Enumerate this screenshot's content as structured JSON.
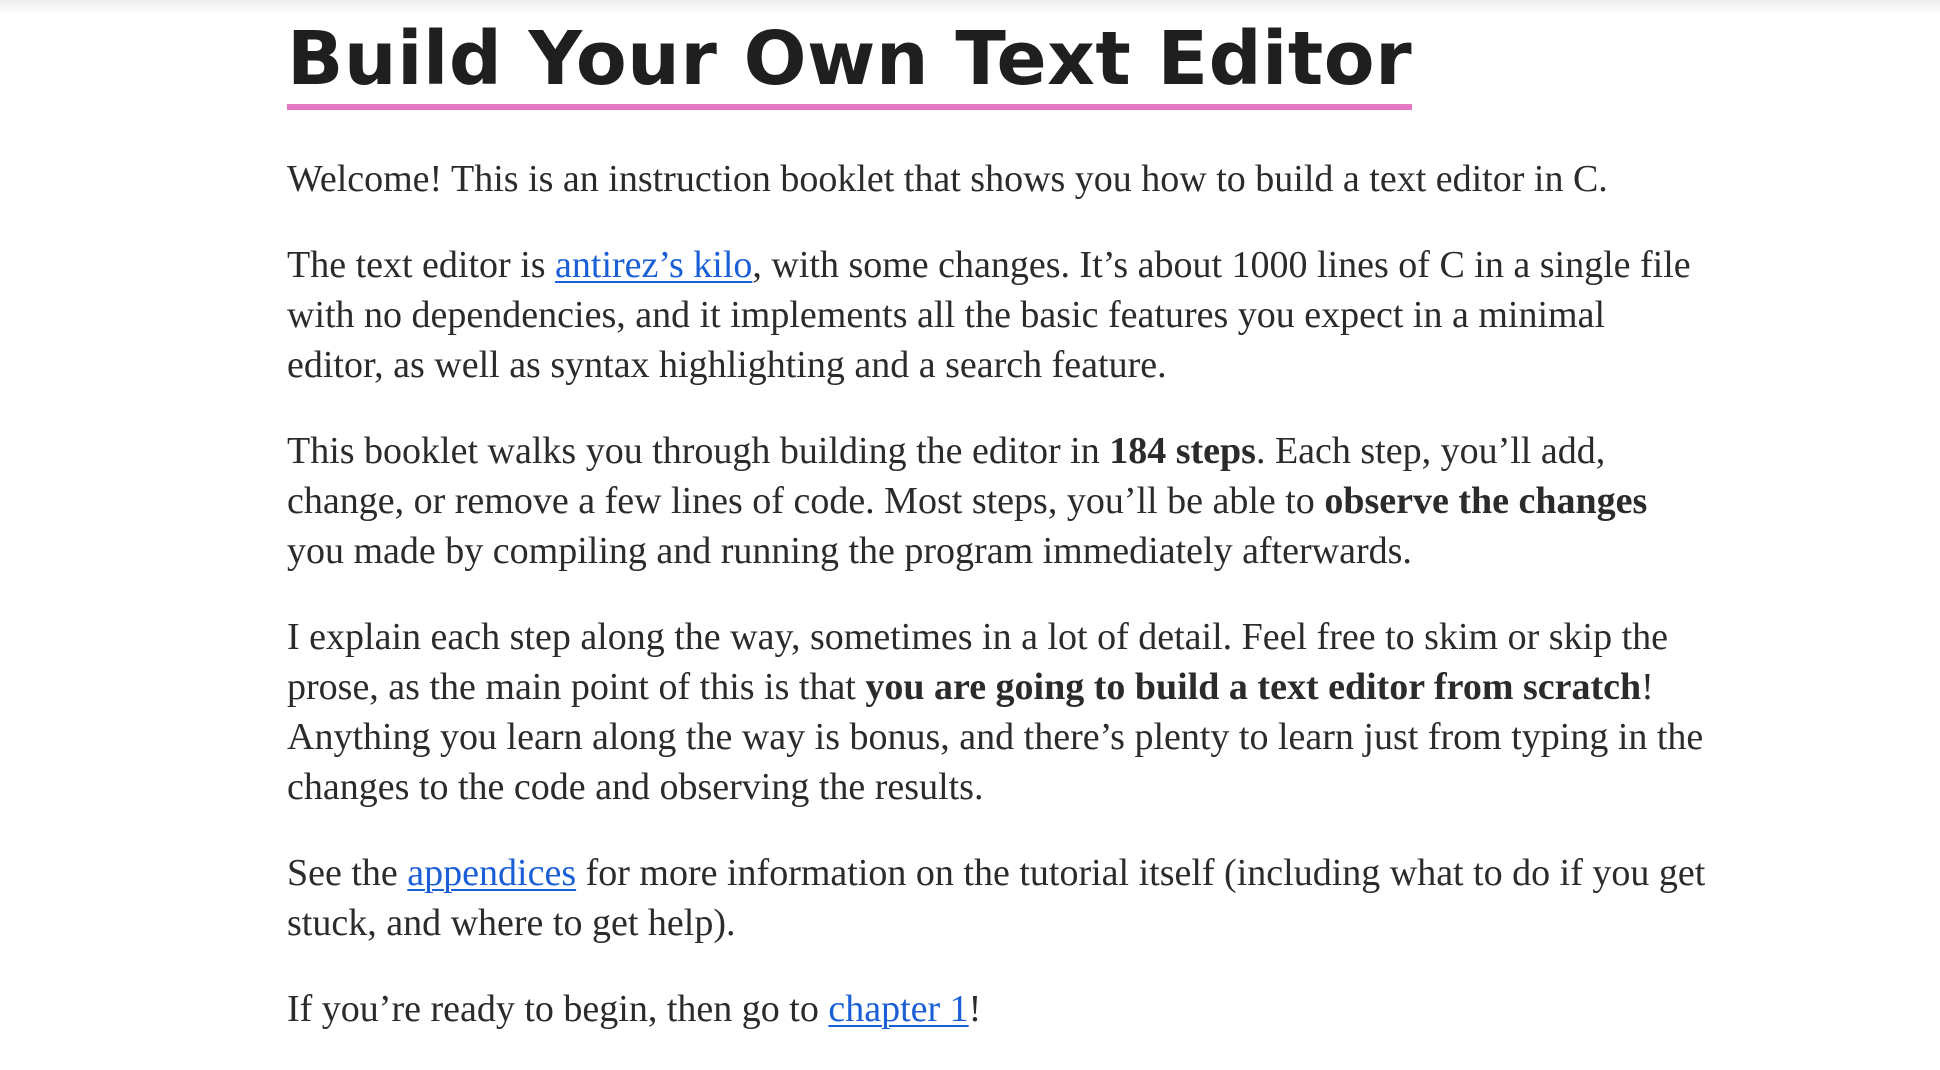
{
  "title": "Build Your Own Text Editor",
  "p1": {
    "text": "Welcome! This is an instruction booklet that shows you how to build a text editor in C."
  },
  "p2": {
    "t1": "The text editor is ",
    "link": "antirez’s kilo",
    "t2": ", with some changes. It’s about 1000 lines of C in a single file with no dependencies, and it implements all the basic features you expect in a minimal editor, as well as syntax highlighting and a search feature."
  },
  "p3": {
    "t1": "This booklet walks you through building the editor in ",
    "b1": "184 steps",
    "t2": ". Each step, you’ll add, change, or remove a few lines of code. Most steps, you’ll be able to ",
    "b2": "observe the changes",
    "t3": " you made by compiling and running the program immediately afterwards."
  },
  "p4": {
    "t1": "I explain each step along the way, sometimes in a lot of detail. Feel free to skim or skip the prose, as the main point of this is that ",
    "b1": "you are going to build a text editor from scratch",
    "t2": "! Anything you learn along the way is bonus, and there’s plenty to learn just from typing in the changes to the code and observing the results."
  },
  "p5": {
    "t1": "See the ",
    "link": "appendices",
    "t2": " for more information on the tutorial itself (including what to do if you get stuck, and where to get help)."
  },
  "p6": {
    "t1": "If you’re ready to begin, then go to ",
    "link": "chapter 1",
    "t2": "!"
  },
  "colors": {
    "text": "#2b2b2b",
    "heading": "#1f1f1f",
    "title_underline": "#e377c2",
    "link": "#1a5fd6",
    "background": "#ffffff"
  }
}
